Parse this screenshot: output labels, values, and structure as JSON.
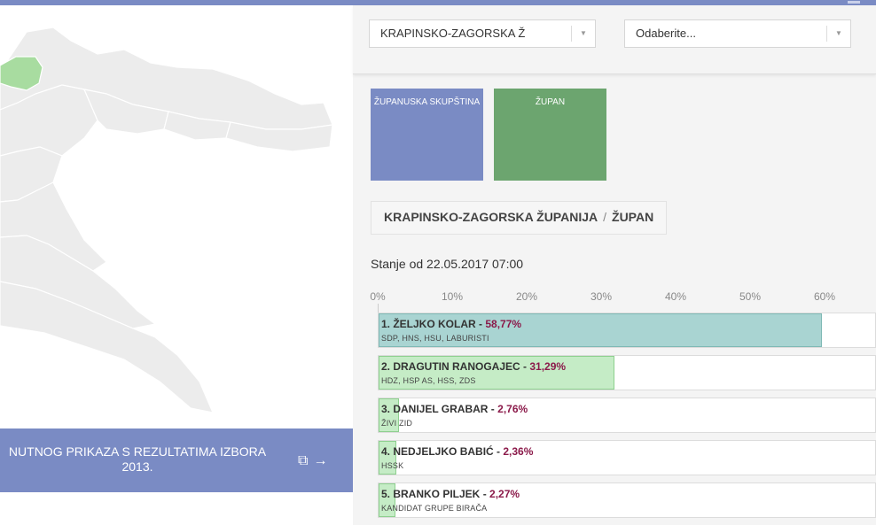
{
  "colors": {
    "accent": "#7a8bc4",
    "zupan_tile": "#6ca56f",
    "lead_bar": "#a9d4d2",
    "other_bar": "#c5ecc6",
    "percent_text": "#8b1a4a"
  },
  "banner": {
    "line1": "NUTNOG PRIKAZA S REZULTATIMA IZBORA",
    "line2": "2013.",
    "icon1": "copy-icon",
    "icon2": "arrow-right-icon"
  },
  "filters": {
    "county": "KRAPINSKO-ZAGORSKA Ž",
    "second": "Odaberite..."
  },
  "tiles": [
    {
      "label": "ŽUPANUSKA SKUPŠTINA"
    },
    {
      "label": "ŽUPAN"
    }
  ],
  "breadcrumb": {
    "county": "KRAPINSKO-ZAGORSKA ŽUPANIJA",
    "sep": "/",
    "office": "ŽUPAN"
  },
  "status": "Stanje od 22.05.2017 07:00",
  "axis_ticks": [
    "0%",
    "10%",
    "20%",
    "30%",
    "40%",
    "50%",
    "60%"
  ],
  "candidates": [
    {
      "name": "1. ŽELJKO KOLAR",
      "percent": "58,77%",
      "share": 58.77,
      "party": "SDP, HNS, HSU, LABURISTI"
    },
    {
      "name": "2. DRAGUTIN RANOGAJEC",
      "percent": "31,29%",
      "share": 31.29,
      "party": "HDZ, HSP AS, HSS, ZDS"
    },
    {
      "name": "3. DANIJEL GRABAR",
      "percent": "2,76%",
      "share": 2.76,
      "party": "ŽIVI ZID"
    },
    {
      "name": "4. NEDJELJKO BABIĆ",
      "percent": "2,36%",
      "share": 2.36,
      "party": "HSSK"
    },
    {
      "name": "5. BRANKO PILJEK",
      "percent": "2,27%",
      "share": 2.27,
      "party": "KANDIDAT GRUPE BIRAČA"
    }
  ]
}
